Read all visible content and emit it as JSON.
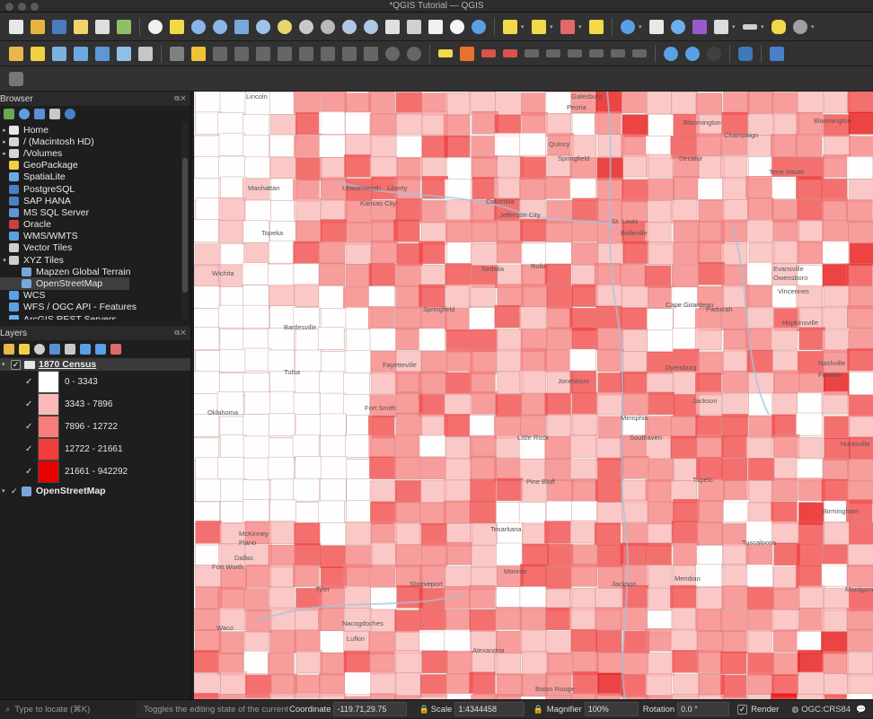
{
  "window": {
    "title": "*QGIS Tutorial — QGIS"
  },
  "browser": {
    "title": "Browser",
    "items": [
      {
        "label": "Home",
        "icon": "home-icon",
        "arrow": "▸",
        "indent": 0
      },
      {
        "label": "/ (Macintosh HD)",
        "icon": "folder-icon",
        "arrow": "▸",
        "indent": 0
      },
      {
        "label": "/Volumes",
        "icon": "folder-icon",
        "arrow": "▸",
        "indent": 0
      },
      {
        "label": "GeoPackage",
        "icon": "geopackage-icon",
        "arrow": "",
        "indent": 0
      },
      {
        "label": "SpatiaLite",
        "icon": "spatialite-icon",
        "arrow": "",
        "indent": 0
      },
      {
        "label": "PostgreSQL",
        "icon": "postgresql-icon",
        "arrow": "",
        "indent": 0
      },
      {
        "label": "SAP HANA",
        "icon": "sap-hana-icon",
        "arrow": "",
        "indent": 0
      },
      {
        "label": "MS SQL Server",
        "icon": "mssql-icon",
        "arrow": "",
        "indent": 0
      },
      {
        "label": "Oracle",
        "icon": "oracle-icon",
        "arrow": "",
        "indent": 0
      },
      {
        "label": "WMS/WMTS",
        "icon": "wms-icon",
        "arrow": "",
        "indent": 0
      },
      {
        "label": "Vector Tiles",
        "icon": "vector-tiles-icon",
        "arrow": "",
        "indent": 0
      },
      {
        "label": "XYZ Tiles",
        "icon": "xyz-tiles-icon",
        "arrow": "▾",
        "indent": 0
      },
      {
        "label": "Mapzen Global Terrain",
        "icon": "tile-icon",
        "arrow": "",
        "indent": 1
      },
      {
        "label": "OpenStreetMap",
        "icon": "tile-icon",
        "arrow": "",
        "indent": 1,
        "selected": true
      },
      {
        "label": "WCS",
        "icon": "wcs-icon",
        "arrow": "",
        "indent": 0
      },
      {
        "label": "WFS / OGC API - Features",
        "icon": "wfs-icon",
        "arrow": "",
        "indent": 0
      },
      {
        "label": "ArcGIS REST Servers",
        "icon": "arcgis-icon",
        "arrow": "",
        "indent": 0
      }
    ]
  },
  "layers": {
    "title": "Layers",
    "census_layer": "1870 Census",
    "osm_layer": "OpenStreetMap",
    "legend": [
      {
        "label": "0 - 3343",
        "color": "#ffffff"
      },
      {
        "label": "3343 - 7896",
        "color": "#fbb9b9"
      },
      {
        "label": "7896 - 12722",
        "color": "#f77c7c"
      },
      {
        "label": "12722 - 21661",
        "color": "#f23d3d"
      },
      {
        "label": "21661 - 942292",
        "color": "#e60000"
      }
    ]
  },
  "map": {
    "places": [
      "Lincoln",
      "Galesburg",
      "Peoria",
      "Bloomington",
      "Champaign",
      "Quincy",
      "Springfield",
      "Decatur",
      "Terre Haute",
      "Bloomington",
      "Leavenworth",
      "Liberty",
      "Kansas City",
      "Columbia",
      "Jefferson City",
      "St. Louis",
      "Belleville",
      "Manhattan",
      "Topeka",
      "Sedalia",
      "Vincennes",
      "Evansville",
      "Owensboro",
      "Wichita",
      "Rolla",
      "Cape Girardeau",
      "Paducah",
      "Bartlesville",
      "Springfield",
      "Hopkinsville",
      "Nashville",
      "Franklin",
      "Fayetteville",
      "Jonesboro",
      "Dyersburg",
      "Jackson",
      "Tulsa",
      "Fort Smith",
      "Memphis",
      "Southaven",
      "Huntsville",
      "Oklahoma",
      "Little Rock",
      "Pine Bluff",
      "Tupelo",
      "Birmingham",
      "McKinney",
      "Plano",
      "Texarkana",
      "Tuscaloosa",
      "Dallas",
      "Fort Worth",
      "Shreveport",
      "Monroe",
      "Jackson",
      "Meridian",
      "Montgomery",
      "Tyler",
      "Nacogdoches",
      "Lufkin",
      "Alexandria",
      "Waco",
      "Baton Rouge"
    ]
  },
  "status": {
    "search_placeholder": "Type to locate (⌘K)",
    "message": "Toggles the editing state of the current lay",
    "coordinate_label": "Coordinate",
    "coordinate_value": "-119.71,29.75",
    "scale_label": "Scale",
    "scale_value": "1:4344458",
    "magnifier_label": "Magnifier",
    "magnifier_value": "100%",
    "rotation_label": "Rotation",
    "rotation_value": "0.0 °",
    "render_label": "Render",
    "crs_value": "OGC:CRS84"
  }
}
